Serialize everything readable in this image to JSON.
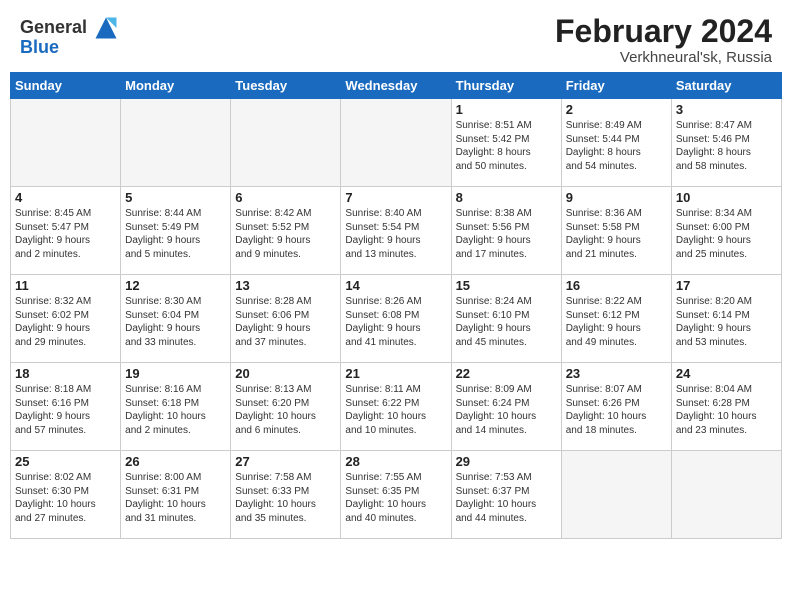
{
  "header": {
    "logo_general": "General",
    "logo_blue": "Blue",
    "title": "February 2024",
    "subtitle": "Verkhneural'sk, Russia"
  },
  "calendar": {
    "days_of_week": [
      "Sunday",
      "Monday",
      "Tuesday",
      "Wednesday",
      "Thursday",
      "Friday",
      "Saturday"
    ],
    "weeks": [
      [
        {
          "num": "",
          "info": "",
          "empty": true
        },
        {
          "num": "",
          "info": "",
          "empty": true
        },
        {
          "num": "",
          "info": "",
          "empty": true
        },
        {
          "num": "",
          "info": "",
          "empty": true
        },
        {
          "num": "1",
          "info": "Sunrise: 8:51 AM\nSunset: 5:42 PM\nDaylight: 8 hours\nand 50 minutes.",
          "empty": false
        },
        {
          "num": "2",
          "info": "Sunrise: 8:49 AM\nSunset: 5:44 PM\nDaylight: 8 hours\nand 54 minutes.",
          "empty": false
        },
        {
          "num": "3",
          "info": "Sunrise: 8:47 AM\nSunset: 5:46 PM\nDaylight: 8 hours\nand 58 minutes.",
          "empty": false
        }
      ],
      [
        {
          "num": "4",
          "info": "Sunrise: 8:45 AM\nSunset: 5:47 PM\nDaylight: 9 hours\nand 2 minutes.",
          "empty": false
        },
        {
          "num": "5",
          "info": "Sunrise: 8:44 AM\nSunset: 5:49 PM\nDaylight: 9 hours\nand 5 minutes.",
          "empty": false
        },
        {
          "num": "6",
          "info": "Sunrise: 8:42 AM\nSunset: 5:52 PM\nDaylight: 9 hours\nand 9 minutes.",
          "empty": false
        },
        {
          "num": "7",
          "info": "Sunrise: 8:40 AM\nSunset: 5:54 PM\nDaylight: 9 hours\nand 13 minutes.",
          "empty": false
        },
        {
          "num": "8",
          "info": "Sunrise: 8:38 AM\nSunset: 5:56 PM\nDaylight: 9 hours\nand 17 minutes.",
          "empty": false
        },
        {
          "num": "9",
          "info": "Sunrise: 8:36 AM\nSunset: 5:58 PM\nDaylight: 9 hours\nand 21 minutes.",
          "empty": false
        },
        {
          "num": "10",
          "info": "Sunrise: 8:34 AM\nSunset: 6:00 PM\nDaylight: 9 hours\nand 25 minutes.",
          "empty": false
        }
      ],
      [
        {
          "num": "11",
          "info": "Sunrise: 8:32 AM\nSunset: 6:02 PM\nDaylight: 9 hours\nand 29 minutes.",
          "empty": false
        },
        {
          "num": "12",
          "info": "Sunrise: 8:30 AM\nSunset: 6:04 PM\nDaylight: 9 hours\nand 33 minutes.",
          "empty": false
        },
        {
          "num": "13",
          "info": "Sunrise: 8:28 AM\nSunset: 6:06 PM\nDaylight: 9 hours\nand 37 minutes.",
          "empty": false
        },
        {
          "num": "14",
          "info": "Sunrise: 8:26 AM\nSunset: 6:08 PM\nDaylight: 9 hours\nand 41 minutes.",
          "empty": false
        },
        {
          "num": "15",
          "info": "Sunrise: 8:24 AM\nSunset: 6:10 PM\nDaylight: 9 hours\nand 45 minutes.",
          "empty": false
        },
        {
          "num": "16",
          "info": "Sunrise: 8:22 AM\nSunset: 6:12 PM\nDaylight: 9 hours\nand 49 minutes.",
          "empty": false
        },
        {
          "num": "17",
          "info": "Sunrise: 8:20 AM\nSunset: 6:14 PM\nDaylight: 9 hours\nand 53 minutes.",
          "empty": false
        }
      ],
      [
        {
          "num": "18",
          "info": "Sunrise: 8:18 AM\nSunset: 6:16 PM\nDaylight: 9 hours\nand 57 minutes.",
          "empty": false
        },
        {
          "num": "19",
          "info": "Sunrise: 8:16 AM\nSunset: 6:18 PM\nDaylight: 10 hours\nand 2 minutes.",
          "empty": false
        },
        {
          "num": "20",
          "info": "Sunrise: 8:13 AM\nSunset: 6:20 PM\nDaylight: 10 hours\nand 6 minutes.",
          "empty": false
        },
        {
          "num": "21",
          "info": "Sunrise: 8:11 AM\nSunset: 6:22 PM\nDaylight: 10 hours\nand 10 minutes.",
          "empty": false
        },
        {
          "num": "22",
          "info": "Sunrise: 8:09 AM\nSunset: 6:24 PM\nDaylight: 10 hours\nand 14 minutes.",
          "empty": false
        },
        {
          "num": "23",
          "info": "Sunrise: 8:07 AM\nSunset: 6:26 PM\nDaylight: 10 hours\nand 18 minutes.",
          "empty": false
        },
        {
          "num": "24",
          "info": "Sunrise: 8:04 AM\nSunset: 6:28 PM\nDaylight: 10 hours\nand 23 minutes.",
          "empty": false
        }
      ],
      [
        {
          "num": "25",
          "info": "Sunrise: 8:02 AM\nSunset: 6:30 PM\nDaylight: 10 hours\nand 27 minutes.",
          "empty": false
        },
        {
          "num": "26",
          "info": "Sunrise: 8:00 AM\nSunset: 6:31 PM\nDaylight: 10 hours\nand 31 minutes.",
          "empty": false
        },
        {
          "num": "27",
          "info": "Sunrise: 7:58 AM\nSunset: 6:33 PM\nDaylight: 10 hours\nand 35 minutes.",
          "empty": false
        },
        {
          "num": "28",
          "info": "Sunrise: 7:55 AM\nSunset: 6:35 PM\nDaylight: 10 hours\nand 40 minutes.",
          "empty": false
        },
        {
          "num": "29",
          "info": "Sunrise: 7:53 AM\nSunset: 6:37 PM\nDaylight: 10 hours\nand 44 minutes.",
          "empty": false
        },
        {
          "num": "",
          "info": "",
          "empty": true
        },
        {
          "num": "",
          "info": "",
          "empty": true
        }
      ]
    ]
  }
}
